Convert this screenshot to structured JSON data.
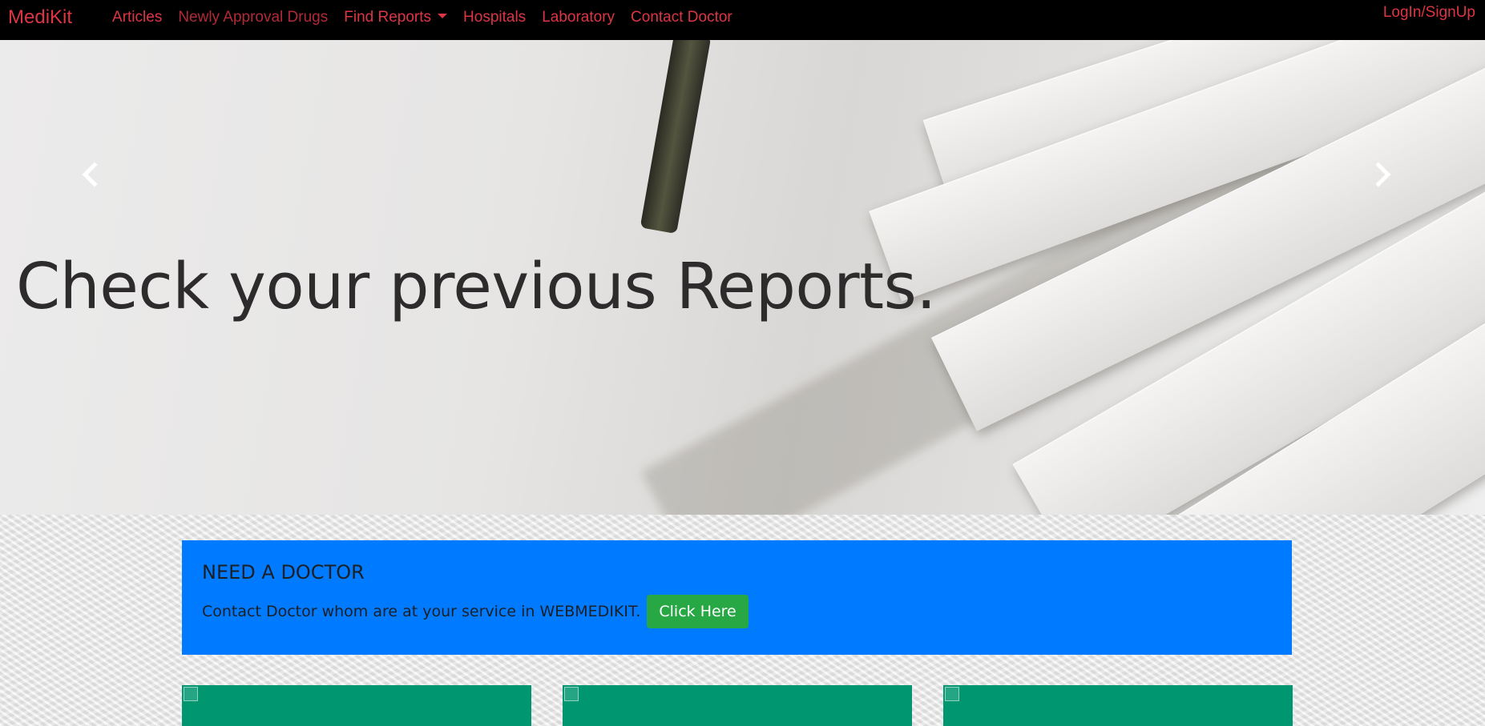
{
  "navbar": {
    "brand": "MediKit",
    "links": [
      "Articles",
      "Newly Approval Drugs",
      "Find Reports",
      "Hospitals",
      "Laboratory",
      "Contact Doctor"
    ],
    "login": "LogIn/SignUp"
  },
  "carousel": {
    "caption": "Check your previous Reports.",
    "active_slide": 3,
    "slide_count": 3
  },
  "doctor": {
    "title": "NEED A DOCTOR",
    "text": "Contact Doctor whom are at your service in WEBMEDIKIT.",
    "button": "Click Here"
  },
  "colors": {
    "nav_text": "#dc3545",
    "banner": "#007bff",
    "button": "#28a745",
    "card": "#009670"
  }
}
